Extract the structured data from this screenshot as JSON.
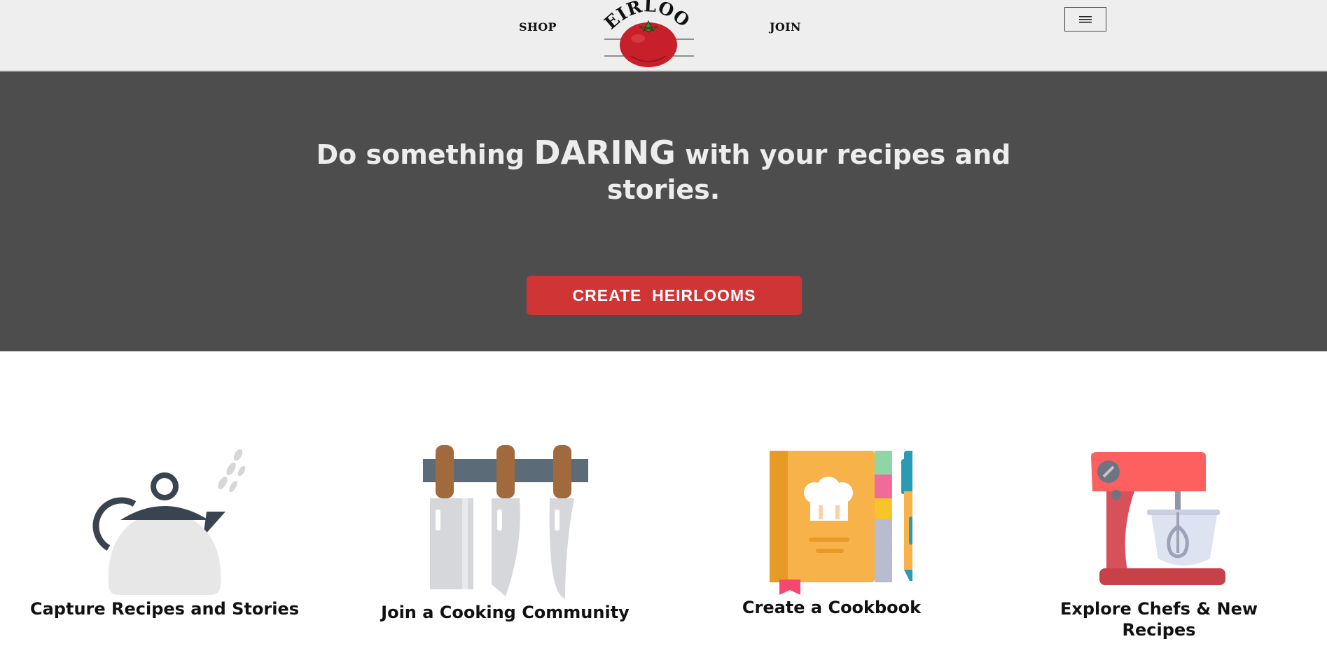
{
  "header": {
    "nav": {
      "shop_label": "SHOP",
      "join_label": "JOIN"
    },
    "logo_text": "HEIRLOOM",
    "menu_icon": "hamburger-icon"
  },
  "hero": {
    "title_part1": "Do something ",
    "title_emphasis": "DARING",
    "title_part2": " with your  recipes and stories.",
    "cta_label": "CREATE  HEIRLOOMS",
    "background_color": "#4d4d4d",
    "cta_color": "#d03536"
  },
  "features": [
    {
      "label": "Capture Recipes and Stories",
      "icon": "kettle-icon"
    },
    {
      "label": "Join a Cooking Community",
      "icon": "knife-rack-icon"
    },
    {
      "label": "Create a Cookbook",
      "icon": "cookbook-icon"
    },
    {
      "label": "Explore Chefs & New Recipes",
      "icon": "stand-mixer-icon"
    }
  ]
}
